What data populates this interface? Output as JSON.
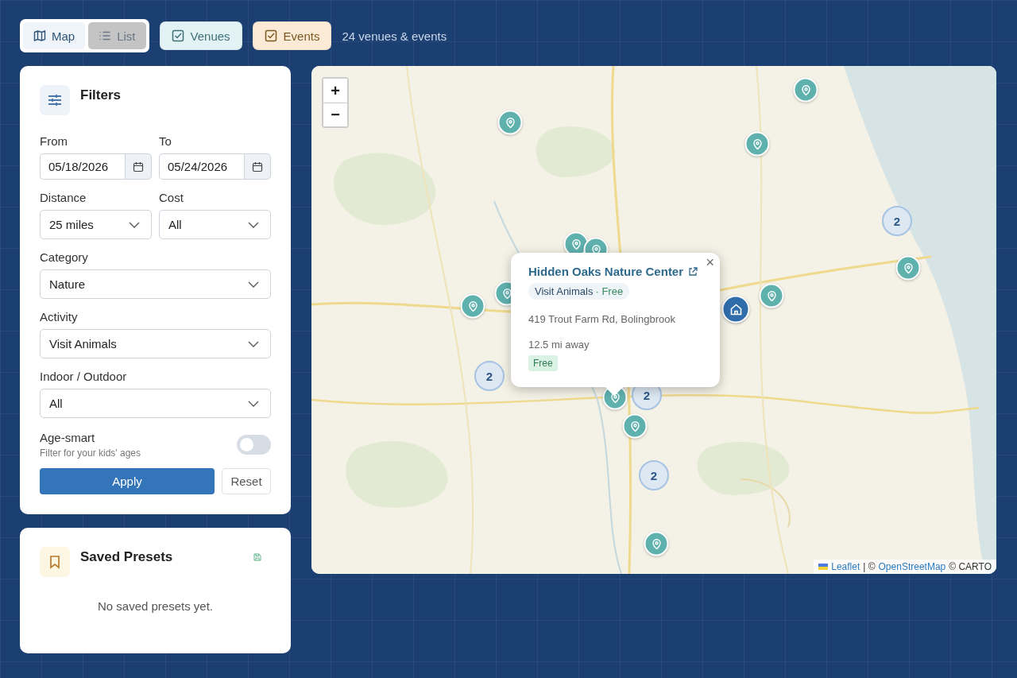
{
  "view_toggle": [
    {
      "label": "Map",
      "kind": "map",
      "selected": true
    },
    {
      "label": "List",
      "kind": "list",
      "selected": false
    }
  ],
  "type_filters": [
    {
      "label": "Venues",
      "checked": true,
      "color": "#e2f2f5"
    },
    {
      "label": "Events",
      "checked": true,
      "color": "#fbebd6"
    }
  ],
  "result_count": "24 venues & events",
  "filters": {
    "title": "Filters",
    "rows": [
      [
        {
          "label": "From",
          "kind": "date",
          "value": "05/18/2026"
        },
        {
          "label": "To",
          "kind": "date",
          "value": "05/24/2026"
        }
      ],
      [
        {
          "label": "Distance",
          "kind": "select",
          "value": "25 miles"
        },
        {
          "label": "Cost",
          "kind": "select",
          "value": "All"
        }
      ],
      [
        {
          "label": "Category",
          "kind": "select",
          "value": "Nature"
        }
      ],
      [
        {
          "label": "Activity",
          "kind": "select",
          "value": "Visit Animals"
        }
      ],
      [
        {
          "label": "Indoor / Outdoor",
          "kind": "select",
          "value": "All"
        }
      ]
    ],
    "age_smart": {
      "label": "Age-smart",
      "hint": "Filter for your kids' ages",
      "on": false
    },
    "apply": "Apply",
    "reset": "Reset"
  },
  "presets": {
    "title": "Saved Presets",
    "empty": "No saved presets yet."
  },
  "map": {
    "zoom_in": "+",
    "zoom_out": "−",
    "markers": [
      {
        "kind": "pin"
      },
      {
        "kind": "pin"
      },
      {
        "kind": "pin"
      },
      {
        "kind": "pin"
      },
      {
        "kind": "pin"
      },
      {
        "kind": "pin"
      },
      {
        "kind": "pin"
      },
      {
        "kind": "pin"
      },
      {
        "kind": "pin"
      },
      {
        "kind": "pin"
      },
      {
        "kind": "pin"
      },
      {
        "kind": "pin"
      },
      {
        "kind": "cluster",
        "count": "2"
      },
      {
        "kind": "cluster",
        "count": "2"
      },
      {
        "kind": "cluster",
        "count": "2"
      },
      {
        "kind": "cluster",
        "count": "2"
      },
      {
        "kind": "home"
      }
    ],
    "popup": {
      "title": "Hidden Oaks Nature Center",
      "close": "×",
      "activity": "Visit Animals",
      "cost_note": "· Free",
      "address": "419 Trout Farm Rd, Bolingbrook",
      "distance": "12.5 mi away",
      "price": "Free"
    },
    "attribution": {
      "leaflet": "Leaflet",
      "separator": "| ©",
      "osm": "OpenStreetMap",
      "carto": "© CARTO"
    }
  }
}
